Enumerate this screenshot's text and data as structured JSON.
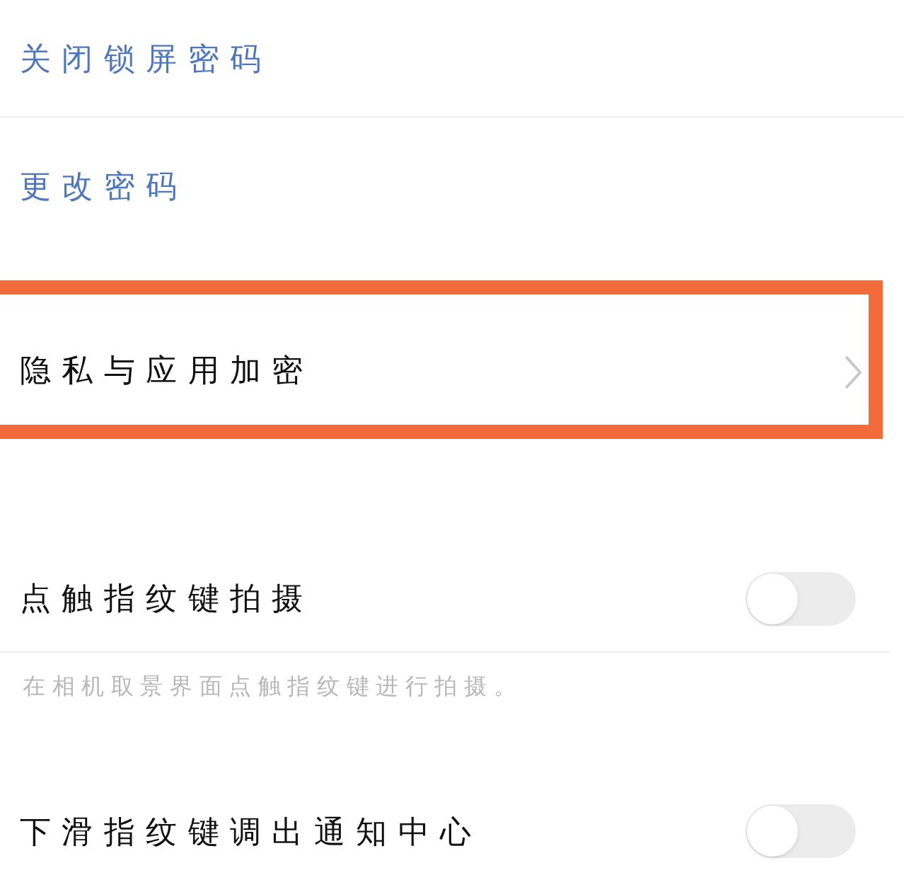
{
  "settings": [
    {
      "kind": "link",
      "label": "关闭锁屏密码"
    },
    {
      "kind": "link",
      "label": "更改密码"
    },
    {
      "kind": "nav",
      "label": "隐私与应用加密",
      "highlighted": true
    },
    {
      "kind": "toggle",
      "label": "点触指纹键拍摄",
      "on": false
    },
    {
      "kind": "note",
      "label": "在相机取景界面点触指纹键进行拍摄。"
    },
    {
      "kind": "toggle",
      "label": "下滑指纹键调出通知中心",
      "on": false
    }
  ]
}
